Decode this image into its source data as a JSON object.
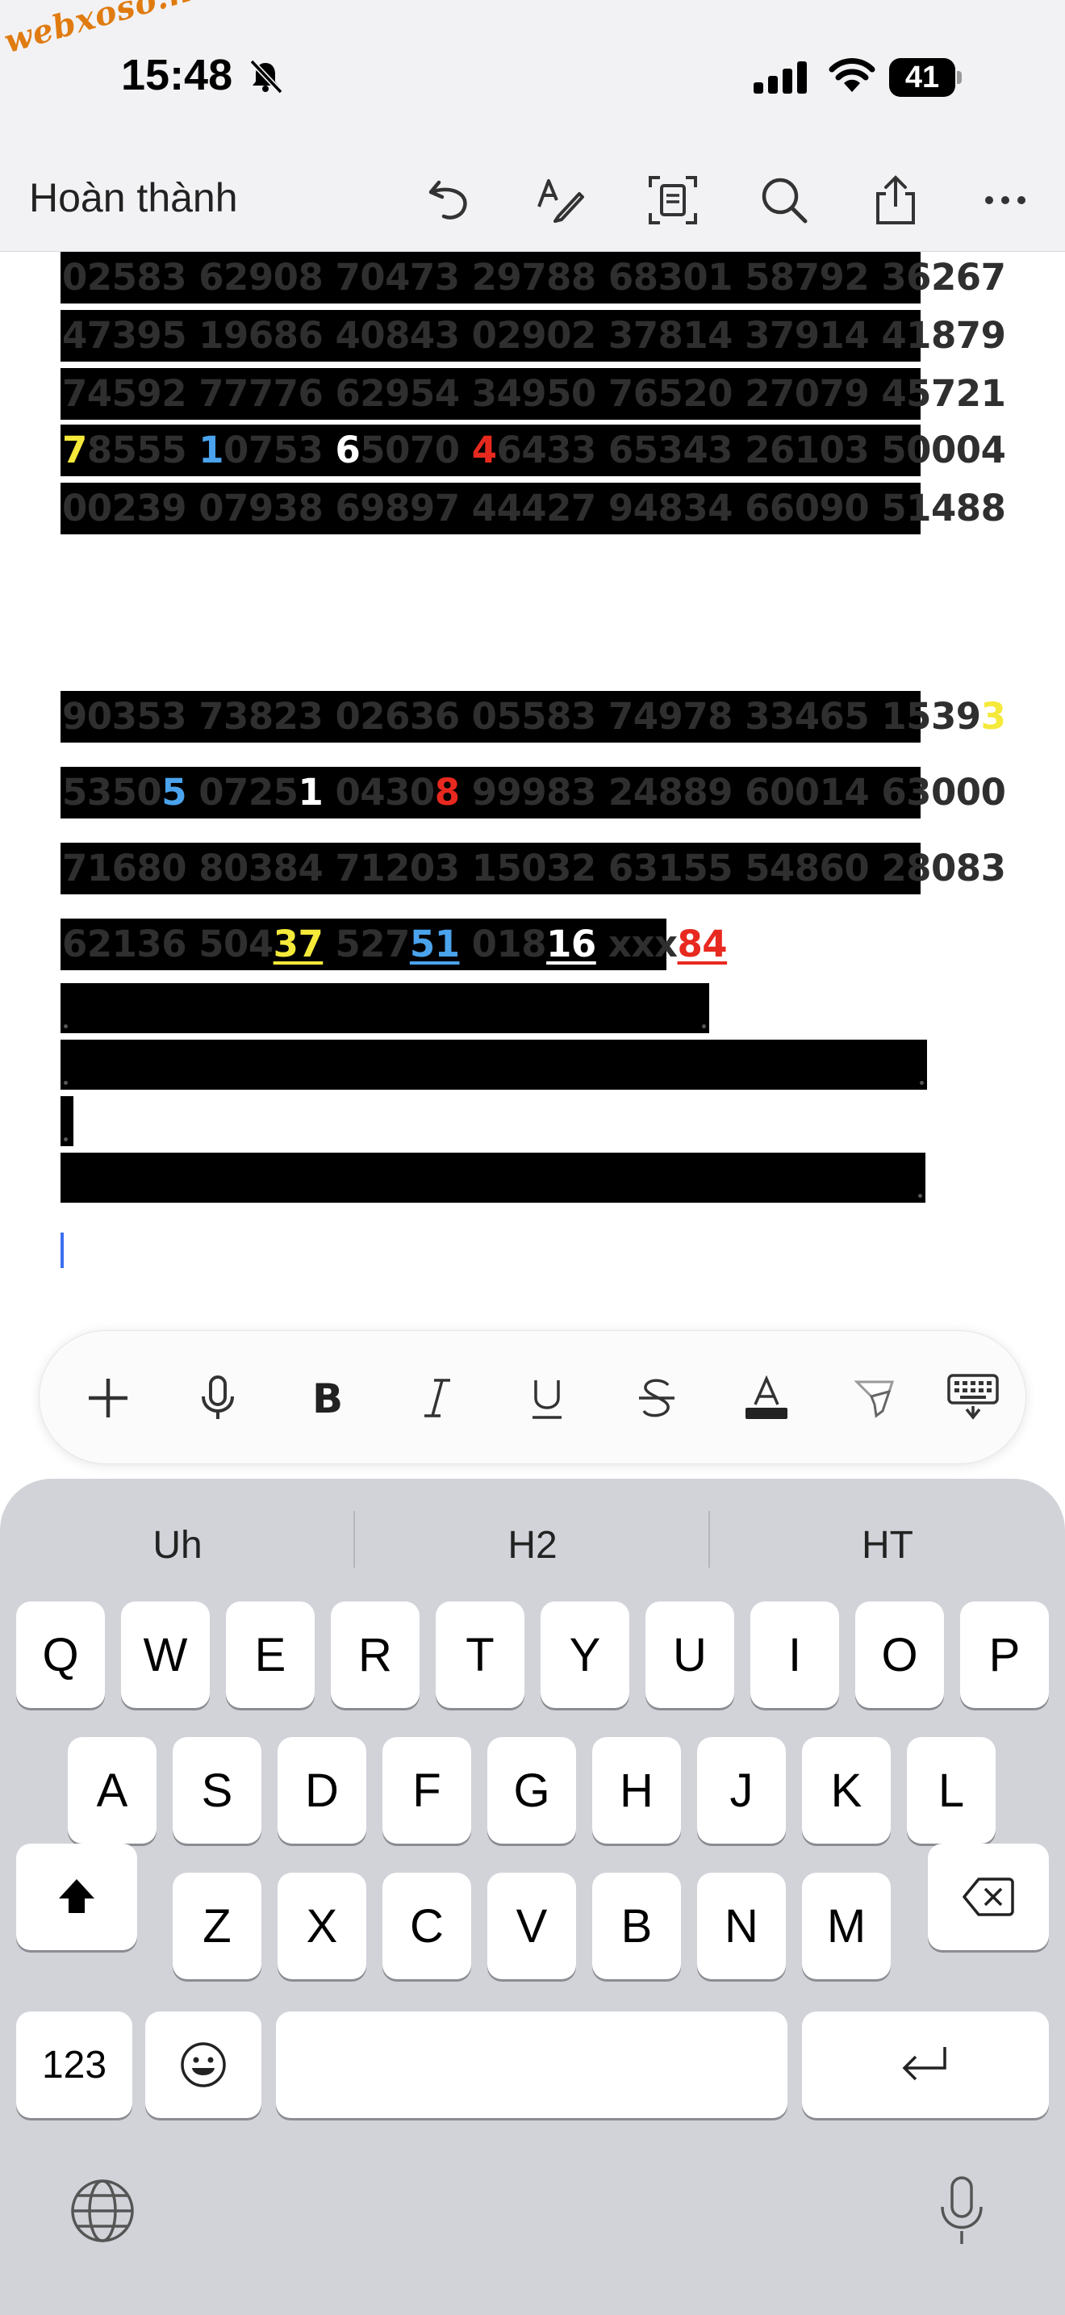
{
  "status": {
    "watermark": "webxoso.net",
    "time": "15:48",
    "battery": "41"
  },
  "toolbar": {
    "done_label": "Hoàn thành"
  },
  "document": {
    "rows": [
      {
        "segments": [
          {
            "t": "02583 62908 70473 29788 68301 58792 36267",
            "c": ""
          }
        ]
      },
      {
        "segments": [
          {
            "t": "47395 19686 40843 02902 37814 37914 41879",
            "c": ""
          }
        ]
      },
      {
        "segments": [
          {
            "t": "74592 77776 62954 34950 76520 27079 45721",
            "c": ""
          }
        ]
      },
      {
        "segments": [
          {
            "t": "7",
            "c": "y"
          },
          {
            "t": "8555 ",
            "c": ""
          },
          {
            "t": "1",
            "c": "b"
          },
          {
            "t": "0753 ",
            "c": ""
          },
          {
            "t": "6",
            "c": "w"
          },
          {
            "t": "5070 ",
            "c": ""
          },
          {
            "t": "4",
            "c": "r"
          },
          {
            "t": "6433 65343 26103 50004",
            "c": ""
          }
        ]
      },
      {
        "segments": [
          {
            "t": "00239 07938 69897 44427 94834 66090 51488",
            "c": ""
          }
        ]
      },
      {
        "segments": [
          {
            "t": "90353 73823 02636 05583 74978 33465 1539",
            "c": ""
          },
          {
            "t": "3",
            "c": "y"
          }
        ]
      },
      {
        "segments": [
          {
            "t": "5350",
            "c": ""
          },
          {
            "t": "5",
            "c": "b"
          },
          {
            "t": " 0725",
            "c": ""
          },
          {
            "t": "1",
            "c": "w"
          },
          {
            "t": " 0430",
            "c": ""
          },
          {
            "t": "8",
            "c": "r"
          },
          {
            "t": " 99983 24889 60014 63000",
            "c": ""
          }
        ]
      },
      {
        "segments": [
          {
            "t": "71680 80384 71203 15032 63155 54860 28083",
            "c": ""
          }
        ]
      },
      {
        "segments": [
          {
            "t": "62136 504",
            "c": ""
          },
          {
            "t": "37",
            "c": "y u"
          },
          {
            "t": " 527",
            "c": ""
          },
          {
            "t": "51",
            "c": "b u"
          },
          {
            "t": " 018",
            "c": ""
          },
          {
            "t": "16",
            "c": "w u"
          },
          {
            "t": " xxx",
            "c": ""
          },
          {
            "t": "84",
            "c": "r u"
          }
        ]
      }
    ]
  },
  "format_bar": {
    "items": [
      "plus-icon",
      "microphone-icon",
      "bold-icon",
      "italic-icon",
      "underline-icon",
      "strikethrough-icon",
      "text-color-icon",
      "highlighter-icon",
      "keyboard-dismiss-icon"
    ]
  },
  "keyboard": {
    "suggestions": [
      "Uh",
      "H2",
      "HT"
    ],
    "row1": [
      "Q",
      "W",
      "E",
      "R",
      "T",
      "Y",
      "U",
      "I",
      "O",
      "P"
    ],
    "row2": [
      "A",
      "S",
      "D",
      "F",
      "G",
      "H",
      "J",
      "K",
      "L"
    ],
    "row3": [
      "Z",
      "X",
      "C",
      "V",
      "B",
      "N",
      "M"
    ],
    "numbers_label": "123"
  }
}
